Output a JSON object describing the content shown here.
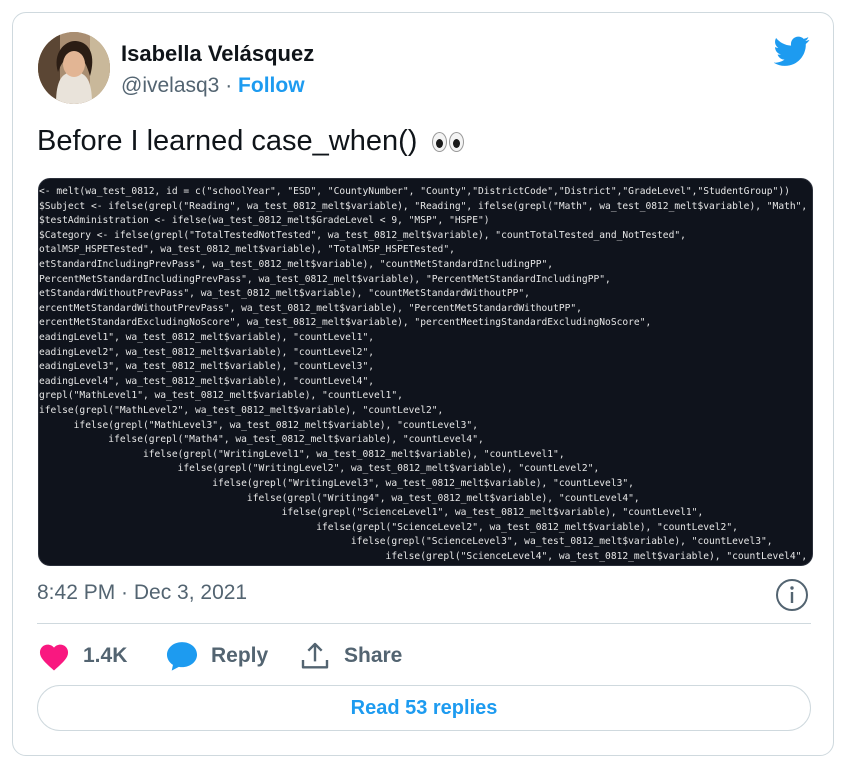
{
  "author": {
    "name": "Isabella Velásquez",
    "handle": "@ivelasq3",
    "separator": " · ",
    "follow_label": "Follow"
  },
  "tweet": {
    "text": "Before I learned case_when()",
    "emoji": "eyes",
    "timestamp": "8:42 PM · Dec 3, 2021"
  },
  "code_lines": [
    "<- melt(wa_test_0812, id = c(\"schoolYear\", \"ESD\", \"CountyNumber\", \"County\",\"DistrictCode\",\"District\",\"GradeLevel\",\"StudentGroup\"))",
    "$Subject <- ifelse(grepl(\"Reading\", wa_test_0812_melt$variable), \"Reading\", ifelse(grepl(\"Math\", wa_test_0812_melt$variable), \"Math\", ifelse(gr",
    "$testAdministration <- ifelse(wa_test_0812_melt$GradeLevel < 9, \"MSP\", \"HSPE\")",
    "$Category <- ifelse(grepl(\"TotalTestedNotTested\", wa_test_0812_melt$variable), \"countTotalTested_and_NotTested\",",
    "otalMSP_HSPETested\", wa_test_0812_melt$variable), \"TotalMSP_HSPETested\",",
    "etStandardIncludingPrevPass\", wa_test_0812_melt$variable), \"countMetStandardIncludingPP\",",
    "PercentMetStandardIncludingPrevPass\", wa_test_0812_melt$variable), \"PercentMetStandardIncludingPP\",",
    "etStandardWithoutPrevPass\", wa_test_0812_melt$variable), \"countMetStandardWithoutPP\",",
    "ercentMetStandardWithoutPrevPass\", wa_test_0812_melt$variable), \"PercentMetStandardWithoutPP\",",
    "ercentMetStandardExcludingNoScore\", wa_test_0812_melt$variable), \"percentMeetingStandardExcludingNoScore\",",
    "eadingLevel1\", wa_test_0812_melt$variable), \"countLevel1\",",
    "eadingLevel2\", wa_test_0812_melt$variable), \"countLevel2\",",
    "eadingLevel3\", wa_test_0812_melt$variable), \"countLevel3\",",
    "eadingLevel4\", wa_test_0812_melt$variable), \"countLevel4\",",
    "grepl(\"MathLevel1\", wa_test_0812_melt$variable), \"countLevel1\",",
    "ifelse(grepl(\"MathLevel2\", wa_test_0812_melt$variable), \"countLevel2\",",
    "      ifelse(grepl(\"MathLevel3\", wa_test_0812_melt$variable), \"countLevel3\",",
    "            ifelse(grepl(\"Math4\", wa_test_0812_melt$variable), \"countLevel4\",",
    "                  ifelse(grepl(\"WritingLevel1\", wa_test_0812_melt$variable), \"countLevel1\",",
    "                        ifelse(grepl(\"WritingLevel2\", wa_test_0812_melt$variable), \"countLevel2\",",
    "                              ifelse(grepl(\"WritingLevel3\", wa_test_0812_melt$variable), \"countLevel3\",",
    "                                    ifelse(grepl(\"Writing4\", wa_test_0812_melt$variable), \"countLevel4\",",
    "                                          ifelse(grepl(\"ScienceLevel1\", wa_test_0812_melt$variable), \"countLevel1\",",
    "                                                ifelse(grepl(\"ScienceLevel2\", wa_test_0812_melt$variable), \"countLevel2\",",
    "                                                      ifelse(grepl(\"ScienceLevel3\", wa_test_0812_melt$variable), \"countLevel3\",",
    "                                                            ifelse(grepl(\"ScienceLevel4\", wa_test_0812_melt$variable), \"countLevel4\","
  ],
  "actions": {
    "likes_count": "1.4K",
    "reply_label": "Reply",
    "share_label": "Share"
  },
  "read_replies_label": "Read 53 replies",
  "colors": {
    "accent": "#1d9bf0",
    "like": "#f91880",
    "muted": "#536471",
    "code_bg": "#0f131c"
  },
  "icons": {
    "brand": "twitter-bird-icon",
    "info": "info-icon",
    "like": "heart-icon",
    "reply": "speech-bubble-icon",
    "share": "share-upload-icon"
  }
}
